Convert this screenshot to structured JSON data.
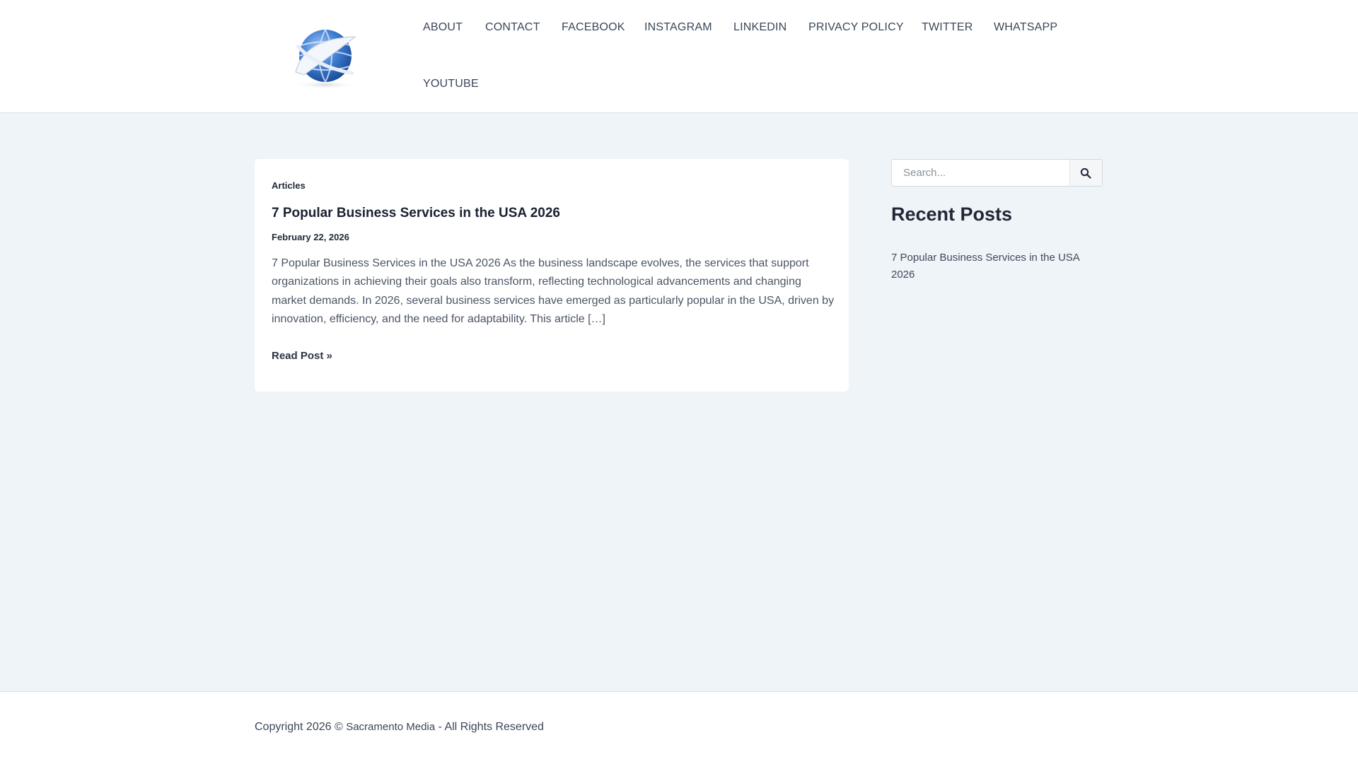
{
  "nav": {
    "items": [
      {
        "label": "ABOUT"
      },
      {
        "label": "CONTACT"
      },
      {
        "label": "FACEBOOK"
      },
      {
        "label": "INSTAGRAM"
      },
      {
        "label": "LINKEDIN"
      },
      {
        "label": "PRIVACY POLICY"
      },
      {
        "label": "TWITTER"
      },
      {
        "label": "WHATSAPP"
      },
      {
        "label": "YOUTUBE"
      }
    ]
  },
  "logo": {
    "icon": "globe-logo-icon"
  },
  "post": {
    "category": "Articles",
    "title": "7 Popular Business Services in the USA 2026",
    "date": "February 22, 2026",
    "excerpt": "7 Popular Business Services in the USA 2026 As the business landscape evolves, the services that support organizations in achieving their goals also transform, reflecting technological advancements and changing market demands. In 2026, several business services have emerged as particularly popular in the USA, driven by innovation, efficiency, and the need for adaptability. This article […]",
    "read_more": "Read Post »"
  },
  "sidebar": {
    "search_placeholder": "Search...",
    "search_icon": "search-icon",
    "recent_title": "Recent Posts",
    "recent_posts": [
      {
        "label": "7 Popular Business Services in the USA 2026"
      }
    ]
  },
  "footer": {
    "copyright_prefix": "Copyright 2026 © ",
    "brand": "Sacramento Media",
    "copyright_suffix": " - All Rights Reserved"
  },
  "colors": {
    "background": "#eff4f9",
    "card": "#ffffff",
    "text": "#364152",
    "heading": "#1a2231"
  }
}
